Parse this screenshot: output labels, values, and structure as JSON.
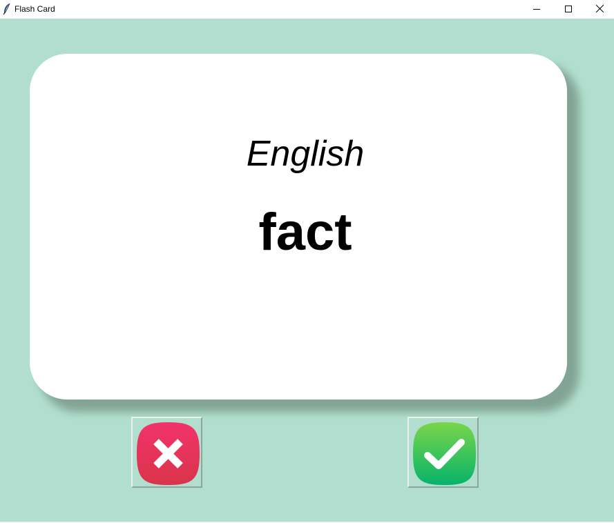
{
  "window": {
    "title": "Flash Card",
    "controls": {
      "minimize_icon": "minimize-icon",
      "maximize_icon": "maximize-icon",
      "close_icon": "close-icon"
    }
  },
  "card": {
    "language": "English",
    "word": "fact"
  },
  "actions": {
    "wrong_icon": "x-mark-icon",
    "right_icon": "check-mark-icon"
  },
  "colors": {
    "background": "#b1dece",
    "card": "#ffffff",
    "wrong_button": "#ea3d5b",
    "right_button": "#3ccf6a"
  }
}
